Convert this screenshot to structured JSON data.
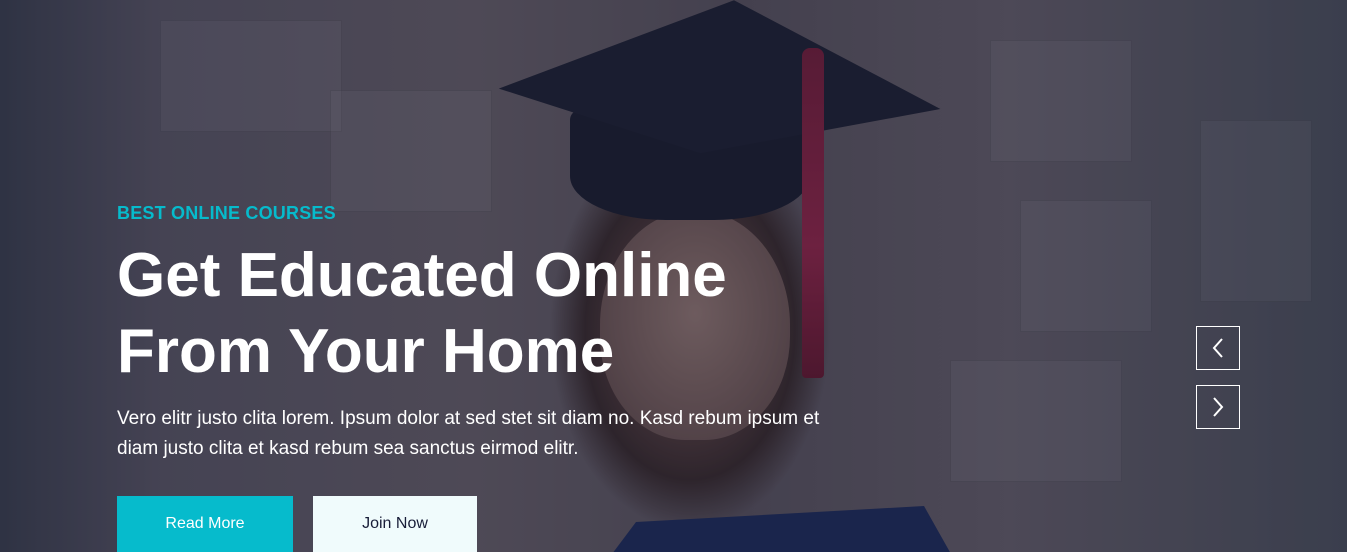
{
  "hero": {
    "eyebrow": "BEST ONLINE COURSES",
    "title": "Get Educated Online From Your Home",
    "description": "Vero elitr justo clita lorem. Ipsum dolor at sed stet sit diam no. Kasd rebum ipsum et diam justo clita et kasd rebum sea sanctus eirmod elitr.",
    "read_more_label": "Read More",
    "join_now_label": "Join Now"
  },
  "carousel": {
    "prev_icon": "chevron-left-icon",
    "next_icon": "chevron-right-icon"
  },
  "colors": {
    "accent": "#06bbcc",
    "light": "#f0fbfc",
    "dark": "#181d38"
  }
}
